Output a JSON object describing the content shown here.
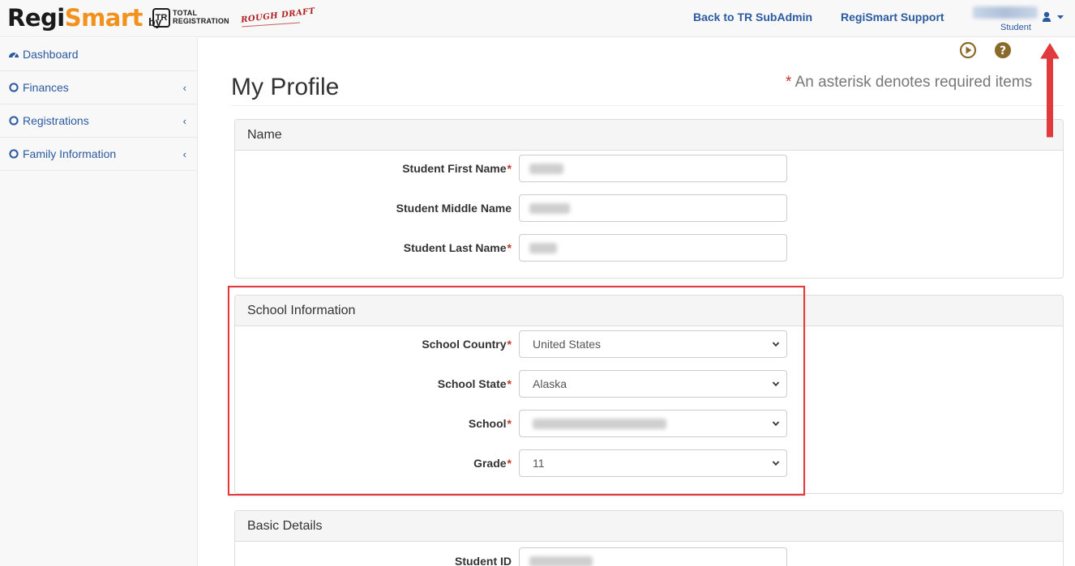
{
  "header": {
    "logo_regi": "Regi",
    "logo_smart": "Smart",
    "logo_by": "by",
    "tr_mark": "TR",
    "tr_line1": "TOTAL",
    "tr_line2": "REGISTRATION",
    "rough_draft": "ROUGH DRAFT",
    "back_link": "Back to TR SubAdmin",
    "support_link": "RegiSmart Support",
    "user_role": "Student",
    "user_icon": "user-icon",
    "caret_icon": "caret-down-icon"
  },
  "sidebar": {
    "items": [
      {
        "label": "Dashboard",
        "icon": "dashboard-icon"
      },
      {
        "label": "Finances",
        "icon": "circle-icon"
      },
      {
        "label": "Registrations",
        "icon": "circle-icon"
      },
      {
        "label": "Family Information",
        "icon": "circle-icon"
      }
    ],
    "chevron": "‹"
  },
  "toolbar": {
    "play_icon": "play-circle-icon",
    "help_icon": "question-circle-icon"
  },
  "page": {
    "title": "My Profile",
    "required_star": "*",
    "required_note": " An asterisk denotes required items"
  },
  "sections": {
    "name": {
      "heading": "Name",
      "first_label": "Student First Name",
      "middle_label": "Student Middle Name",
      "last_label": "Student Last Name"
    },
    "school": {
      "heading": "School Information",
      "country_label": "School Country",
      "country_value": "United States",
      "state_label": "School State",
      "state_value": "Alaska",
      "school_label": "School",
      "grade_label": "Grade",
      "grade_value": "11"
    },
    "basic": {
      "heading": "Basic Details",
      "student_id_label": "Student ID"
    }
  },
  "required_marker": "*",
  "colors": {
    "accent_link": "#2c5aa0",
    "brand_orange": "#f2921d",
    "required_red": "#c0392b",
    "highlight_red": "#e03a3f",
    "icon_brown": "#8a6a2a"
  }
}
